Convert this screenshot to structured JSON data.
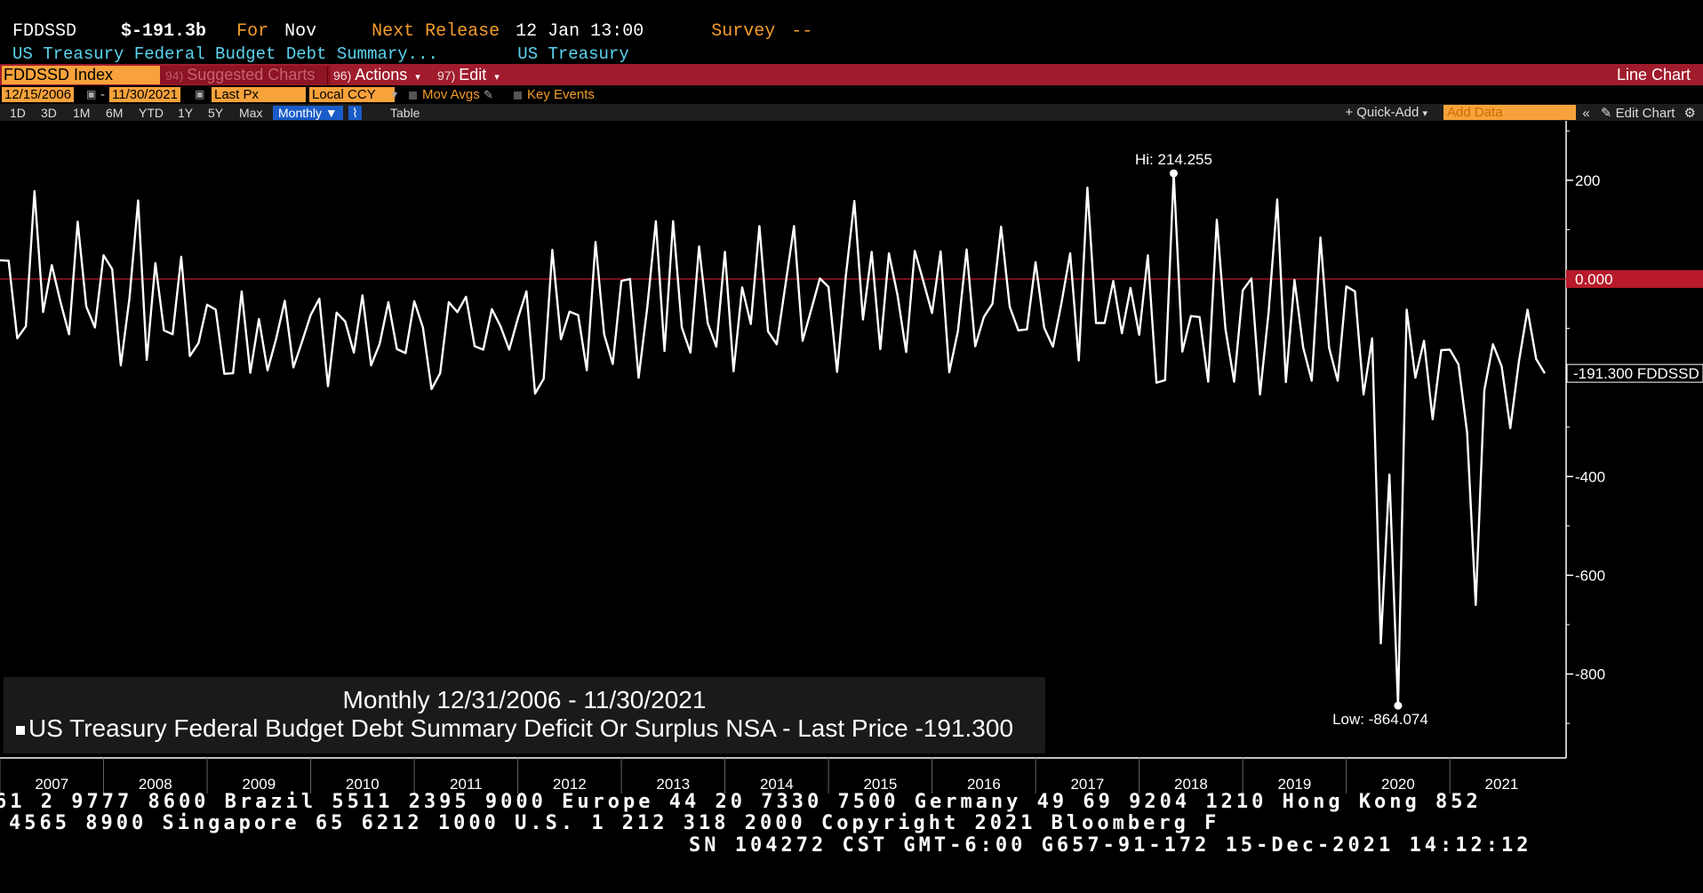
{
  "header": {
    "ticker": "FDDSSD",
    "price": "$-191.3b",
    "for_label": "For",
    "for_value": "Nov",
    "next_release_label": "Next Release",
    "next_release_value": "12 Jan 13:00",
    "survey_label": "Survey",
    "survey_value": "--",
    "description": "US Treasury Federal Budget Debt Summary...",
    "source": "US Treasury"
  },
  "toolbar": {
    "security": "FDDSSD Index",
    "suggested_num": "94)",
    "suggested_label": "Suggested Charts",
    "actions_num": "96)",
    "actions_label": "Actions",
    "edit_num": "97)",
    "edit_label": "Edit",
    "chart_type": "Line Chart",
    "start_date": "12/15/2006",
    "end_date": "11/30/2021",
    "field": "Last Px",
    "currency": "Local CCY",
    "mov_avgs": "Mov Avgs",
    "key_events": "Key Events",
    "periods": [
      "1D",
      "3D",
      "1M",
      "6M",
      "YTD",
      "1Y",
      "5Y",
      "Max"
    ],
    "frequency": "Monthly",
    "table_label": "Table",
    "quick_add": "+ Quick-Add",
    "add_data_placeholder": "Add Data",
    "edit_chart": "Edit Chart"
  },
  "chart_data": {
    "type": "line",
    "ylim": [
      -960,
      310
    ],
    "yticks": [
      200,
      -400,
      -600,
      -800
    ],
    "xlabels": [
      "2007",
      "2008",
      "2009",
      "2010",
      "2011",
      "2012",
      "2013",
      "2014",
      "2015",
      "2016",
      "2017",
      "2018",
      "2019",
      "2020",
      "2021"
    ],
    "x_start": "2006-12-31",
    "x_end": "2021-11-30",
    "series": [
      {
        "name": "US Treasury Federal Budget Debt Summary Deficit Or Surplus NSA",
        "values": [
          38,
          37,
          -120,
          -96,
          178,
          -67,
          28,
          -46,
          -112,
          116,
          -56,
          -98,
          48,
          20,
          -175,
          -40,
          159,
          -164,
          32,
          -104,
          -112,
          45,
          -156,
          -130,
          -52,
          -62,
          -192,
          -191,
          -25,
          -190,
          -81,
          -185,
          -121,
          -44,
          -179,
          -127,
          -73,
          -40,
          -217,
          -68,
          -86,
          -149,
          -33,
          -175,
          -131,
          -47,
          -142,
          -150,
          -45,
          -98,
          -223,
          -191,
          -47,
          -67,
          -36,
          -136,
          -143,
          -61,
          -96,
          -143,
          -80,
          -25,
          -232,
          -202,
          59,
          -122,
          -66,
          -73,
          -185,
          75,
          -112,
          -172,
          -4,
          0,
          -200,
          -58,
          117,
          -146,
          117,
          -98,
          -149,
          66,
          -89,
          -137,
          55,
          -187,
          -17,
          -91,
          107,
          -106,
          -132,
          -13,
          107,
          -125,
          -62,
          1,
          -16,
          -188,
          4,
          158,
          -82,
          55,
          -142,
          52,
          -33,
          -148,
          57,
          -5,
          -69,
          56,
          -189,
          -105,
          60,
          -136,
          -77,
          -50,
          106,
          -56,
          -104,
          -102,
          34,
          -99,
          -137,
          -48,
          52,
          -165,
          185,
          -89,
          -89,
          -4,
          -110,
          -18,
          -113,
          48,
          -210,
          -205,
          214,
          -147,
          -75,
          -77,
          -208,
          120,
          -101,
          -208,
          -23,
          1,
          -234,
          -67,
          161,
          -209,
          -2,
          -138,
          -206,
          84,
          -139,
          -206,
          -15,
          -25,
          -234,
          -120,
          -738,
          -396,
          -864,
          -62,
          -200,
          -125,
          -284,
          -144,
          -143,
          -173,
          -311,
          -660,
          -225,
          -132,
          -177,
          -302,
          -167,
          -62,
          -162,
          -191
        ]
      }
    ],
    "hi_label": "Hi: 214.255",
    "low_label": "Low: -864.074",
    "zero_label": "0.000",
    "last_label": "-191.300 FDDSSD",
    "legend_title": "Monthly 12/31/2006 - 11/30/2021",
    "legend_series": "US Treasury Federal Budget Debt Summary Deficit Or Surplus NSA - Last Price -191.300",
    "colors": {
      "line": "#ffffff",
      "zero_line": "#b81a2a",
      "zero_tag": "#b81a2a"
    }
  },
  "footer": {
    "line1": "61 2 9777 8600 Brazil 5511 2395 9000 Europe 44 20 7330 7500 Germany 49 69 9204 1210 Hong Kong 852",
    "line2": "4565 8900        Singapore 65 6212 1000        U.S. 1 212 318 2000           Copyright 2021 Bloomberg F",
    "line3": "SN 104272 CST  GMT-6:00 G657-91-172 15-Dec-2021 14:12:12"
  }
}
